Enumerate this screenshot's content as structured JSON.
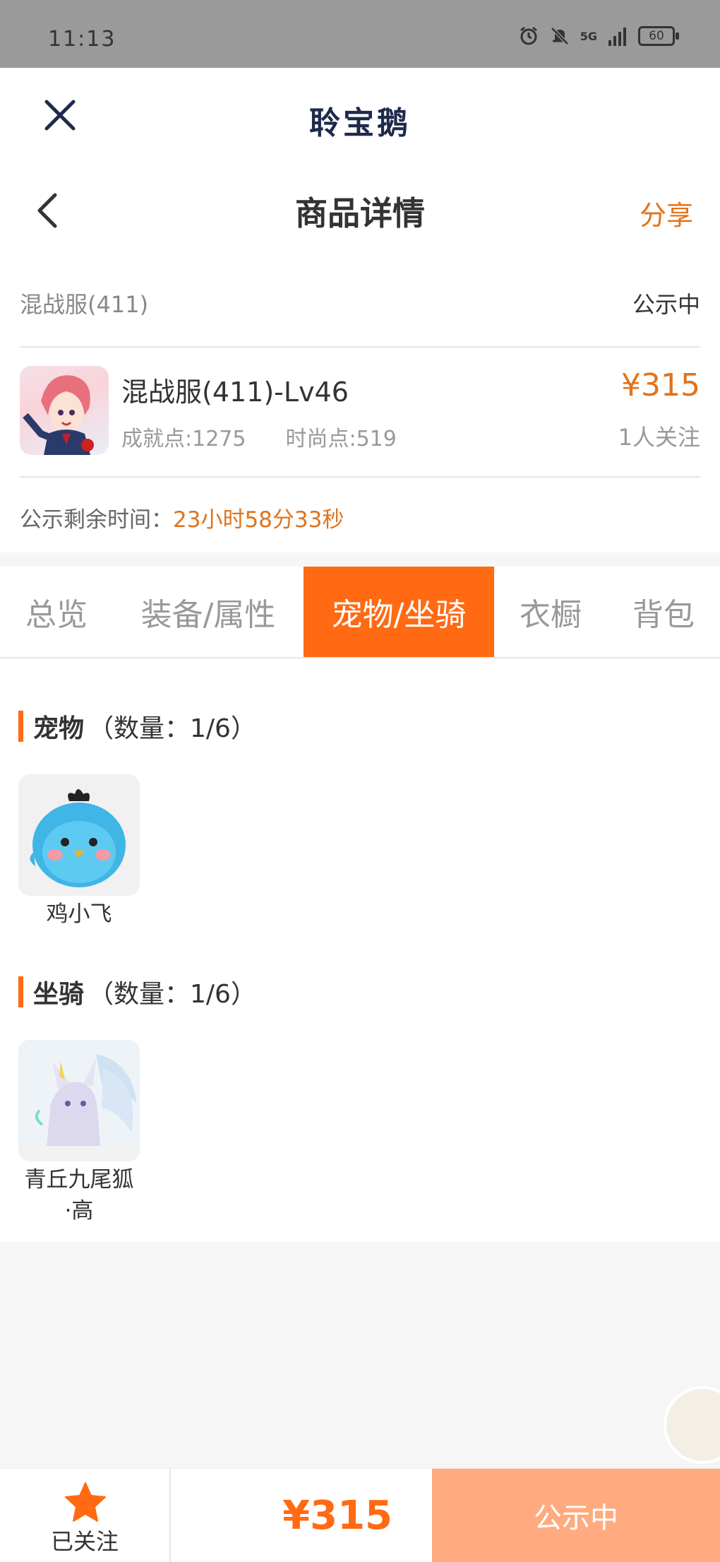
{
  "status_bar": {
    "time": "11:13",
    "battery": "60",
    "signal": "5G"
  },
  "app": {
    "title": "聆宝鹅"
  },
  "nav": {
    "title": "商品详情",
    "share": "分享"
  },
  "listing": {
    "server": "混战服(411)",
    "status": "公示中",
    "name": "混战服(411)-Lv46",
    "achievement": "成就点:1275",
    "fashion": "时尚点:519",
    "price": "¥315",
    "followers": "1人关注",
    "timer_label": "公示剩余时间：",
    "timer_value": "23小时58分33秒"
  },
  "tabs": [
    {
      "label": "总览",
      "active": false
    },
    {
      "label": "装备/属性",
      "active": false
    },
    {
      "label": "宠物/坐骑",
      "active": true
    },
    {
      "label": "衣橱",
      "active": false
    },
    {
      "label": "背包",
      "active": false
    }
  ],
  "pets": {
    "title": "宠物",
    "count": "（数量：1/6）",
    "items": [
      {
        "name": "鸡小飞"
      }
    ]
  },
  "mounts": {
    "title": "坐骑",
    "count": "（数量：1/6）",
    "items": [
      {
        "name": "青丘九尾狐\n·高"
      }
    ]
  },
  "bottom": {
    "follow_label": "已关注",
    "price": "¥315",
    "action": "公示中"
  },
  "colors": {
    "accent": "#ff6a13",
    "price": "#e0731c",
    "action_bg": "#ffab7f"
  }
}
